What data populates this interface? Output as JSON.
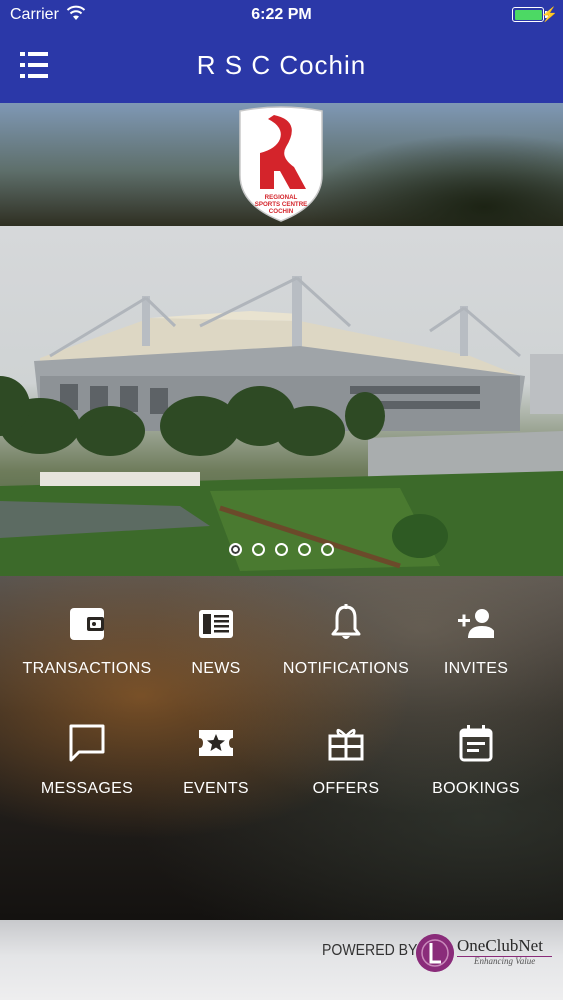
{
  "status_bar": {
    "carrier": "Carrier",
    "time": "6:22 PM"
  },
  "nav": {
    "title": "R S C Cochin"
  },
  "logo": {
    "line1": "REGIONAL",
    "line2": "SPORTS CENTRE",
    "line3": "COCHIN"
  },
  "carousel": {
    "slide_count": 5,
    "active_index": 0
  },
  "menu": [
    {
      "label": "TRANSACTIONS",
      "icon": "wallet-icon"
    },
    {
      "label": "NEWS",
      "icon": "news-icon"
    },
    {
      "label": "NOTIFICATIONS",
      "icon": "bell-icon"
    },
    {
      "label": "INVITES",
      "icon": "add-person-icon"
    },
    {
      "label": "MESSAGES",
      "icon": "chat-bubble-icon"
    },
    {
      "label": "EVENTS",
      "icon": "ticket-star-icon"
    },
    {
      "label": "OFFERS",
      "icon": "gift-icon"
    },
    {
      "label": "BOOKINGS",
      "icon": "calendar-icon"
    }
  ],
  "footer": {
    "powered_by": "POWERED BY",
    "brand": "OneClubNet",
    "tagline": "Enhancing Value"
  },
  "colors": {
    "nav_blue": "#2b38a8",
    "brand_purple": "#8a2c7a",
    "logo_red": "#d4242b",
    "battery_green": "#4cd964"
  }
}
